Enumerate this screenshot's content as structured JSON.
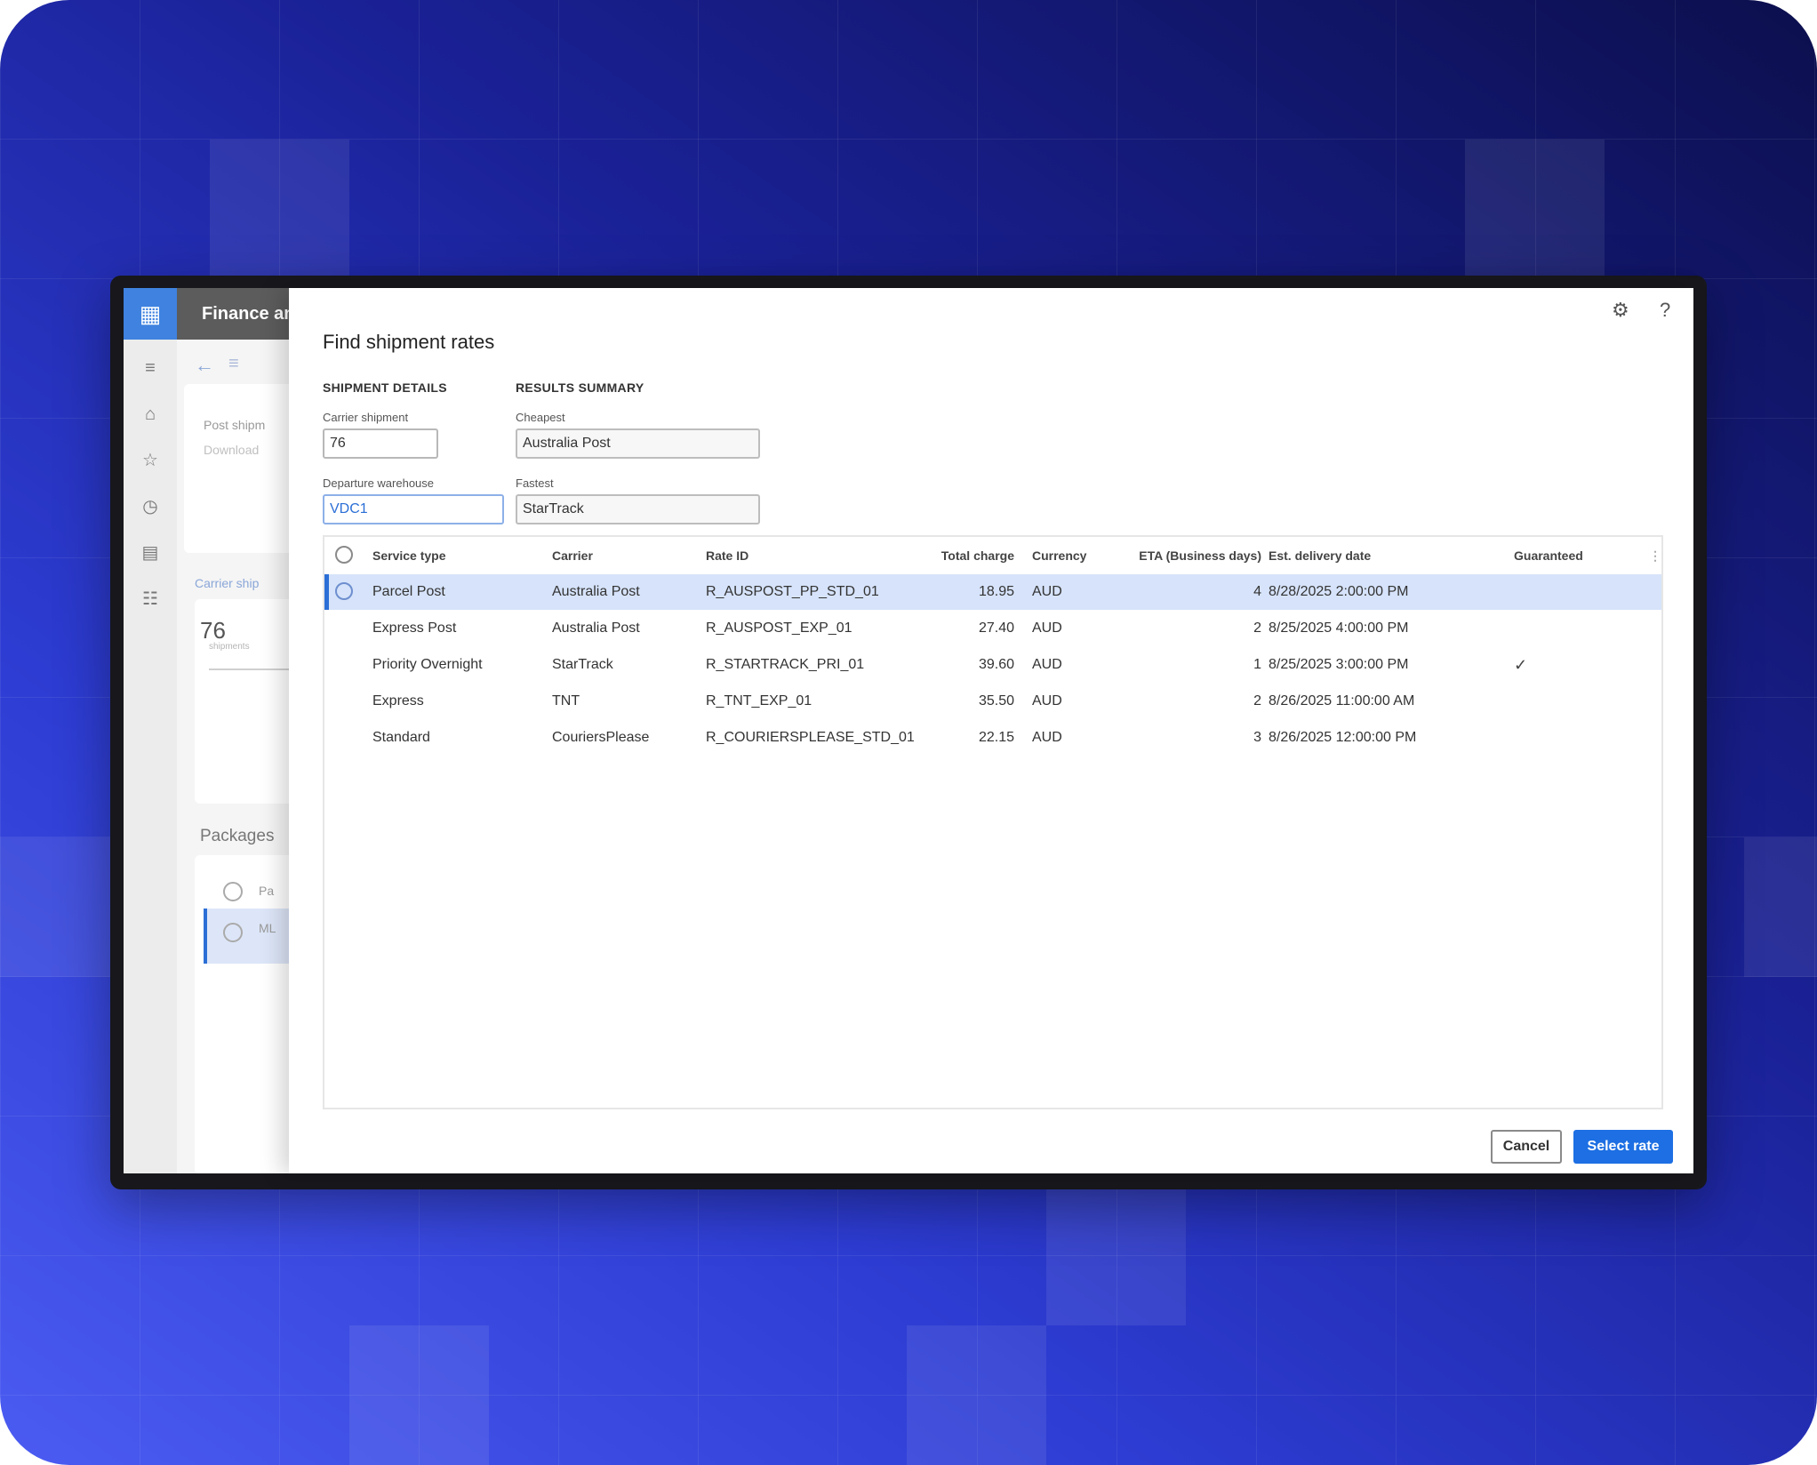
{
  "app": {
    "title": "Finance an",
    "bg_text": {
      "post_shipment": "Post shipm",
      "download": "Download",
      "carrier_shipment": "Carrier ship",
      "carrier_value": "76",
      "shipments": "shipments",
      "packages": "Packages",
      "pkg_row1": "Pa",
      "pkg_row2": "ML"
    }
  },
  "dialog": {
    "title": "Find shipment rates",
    "shipment_details": {
      "heading": "SHIPMENT DETAILS",
      "carrier_shipment_label": "Carrier shipment",
      "carrier_shipment_value": "76",
      "departure_warehouse_label": "Departure warehouse",
      "departure_warehouse_value": "VDC1"
    },
    "results_summary": {
      "heading": "RESULTS SUMMARY",
      "cheapest_label": "Cheapest",
      "cheapest_value": "Australia Post",
      "fastest_label": "Fastest",
      "fastest_value": "StarTrack"
    },
    "grid": {
      "columns": [
        "Service type",
        "Carrier",
        "Rate ID",
        "Total charge",
        "Currency",
        "ETA (Business days)",
        "Est. delivery date",
        "Guaranteed"
      ],
      "rows": [
        {
          "service_type": "Parcel Post",
          "carrier": "Australia Post",
          "rate_id": "R_AUSPOST_PP_STD_01",
          "total_charge": "18.95",
          "currency": "AUD",
          "eta": "4",
          "delivery_date": "8/28/2025 2:00:00 PM",
          "guaranteed": false,
          "selected": true
        },
        {
          "service_type": "Express Post",
          "carrier": "Australia Post",
          "rate_id": "R_AUSPOST_EXP_01",
          "total_charge": "27.40",
          "currency": "AUD",
          "eta": "2",
          "delivery_date": "8/25/2025 4:00:00 PM",
          "guaranteed": false,
          "selected": false
        },
        {
          "service_type": "Priority Overnight",
          "carrier": "StarTrack",
          "rate_id": "R_STARTRACK_PRI_01",
          "total_charge": "39.60",
          "currency": "AUD",
          "eta": "1",
          "delivery_date": "8/25/2025 3:00:00 PM",
          "guaranteed": true,
          "selected": false
        },
        {
          "service_type": "Express",
          "carrier": "TNT",
          "rate_id": "R_TNT_EXP_01",
          "total_charge": "35.50",
          "currency": "AUD",
          "eta": "2",
          "delivery_date": "8/26/2025 11:00:00 AM",
          "guaranteed": false,
          "selected": false
        },
        {
          "service_type": "Standard",
          "carrier": "CouriersPlease",
          "rate_id": "R_COURIERSPLEASE_STD_01",
          "total_charge": "22.15",
          "currency": "AUD",
          "eta": "3",
          "delivery_date": "8/26/2025 12:00:00 PM",
          "guaranteed": false,
          "selected": false
        }
      ],
      "check_glyph": "✓"
    },
    "buttons": {
      "cancel": "Cancel",
      "select_rate": "Select rate"
    },
    "icons": {
      "settings": "⚙",
      "help": "?"
    }
  },
  "colors": {
    "accent": "#1d6fe3",
    "selected_row": "#d6e3fa"
  }
}
